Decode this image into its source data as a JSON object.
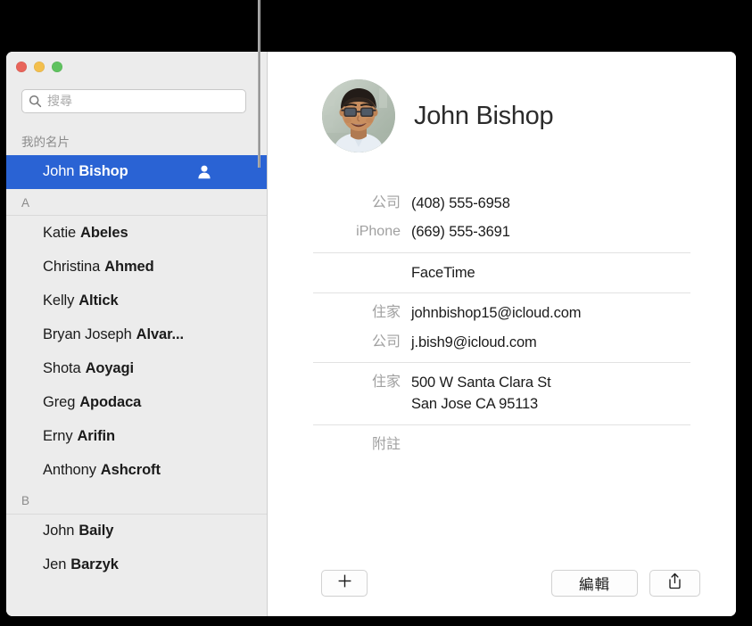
{
  "callout": {
    "name": "callout-line"
  },
  "window": {
    "traffic_lights": [
      {
        "name": "close-button",
        "color": "#e8645a"
      },
      {
        "name": "minimize-button",
        "color": "#f3bf4d"
      },
      {
        "name": "zoom-button",
        "color": "#5fc25f"
      }
    ]
  },
  "sidebar": {
    "search": {
      "placeholder": "搜尋",
      "value": "",
      "icon": "search-icon"
    },
    "groups": [
      {
        "header": "我的名片",
        "ruled": false,
        "rows": [
          {
            "first": "John",
            "last": "Bishop",
            "selected": true,
            "badge": "me-card-person-icon"
          }
        ]
      },
      {
        "header": "A",
        "ruled": true,
        "rows": [
          {
            "first": "Katie",
            "last": "Abeles",
            "selected": false
          },
          {
            "first": "Christina",
            "last": "Ahmed",
            "selected": false
          },
          {
            "first": "Kelly",
            "last": "Altick",
            "selected": false
          },
          {
            "first": "Bryan Joseph",
            "last": "Alvar...",
            "selected": false
          },
          {
            "first": "Shota",
            "last": "Aoyagi",
            "selected": false
          },
          {
            "first": "Greg",
            "last": "Apodaca",
            "selected": false
          },
          {
            "first": "Erny",
            "last": "Arifin",
            "selected": false
          },
          {
            "first": "Anthony",
            "last": "Ashcroft",
            "selected": false
          }
        ]
      },
      {
        "header": "B",
        "ruled": true,
        "rows": [
          {
            "first": "John",
            "last": "Baily",
            "selected": false
          },
          {
            "first": "Jen",
            "last": "Barzyk",
            "selected": false
          }
        ]
      }
    ],
    "selection_color": "#2a63d4"
  },
  "detail": {
    "avatar": {
      "name": "contact-avatar",
      "alt": "John Bishop photo"
    },
    "name": "John Bishop",
    "field_groups": [
      {
        "name": "phone-group",
        "fields": [
          {
            "label": "公司",
            "value": "(408) 555-6958"
          },
          {
            "label": "iPhone",
            "value": "(669) 555-3691"
          }
        ]
      },
      {
        "name": "facetime-group",
        "fields": [
          {
            "label": "",
            "value": "FaceTime"
          }
        ]
      },
      {
        "name": "email-group",
        "fields": [
          {
            "label": "住家",
            "value": "johnbishop15@icloud.com"
          },
          {
            "label": "公司",
            "value": "j.bish9@icloud.com"
          }
        ]
      },
      {
        "name": "address-group",
        "fields": [
          {
            "label": "住家",
            "value": "500 W Santa Clara St\nSan Jose CA 95113"
          }
        ]
      },
      {
        "name": "note-group",
        "fields": [
          {
            "label": "附註",
            "value": ""
          }
        ]
      }
    ]
  },
  "toolbar": {
    "add_label": "+",
    "add_icon": "plus-icon",
    "edit_label": "編輯",
    "share_icon": "share-icon"
  }
}
